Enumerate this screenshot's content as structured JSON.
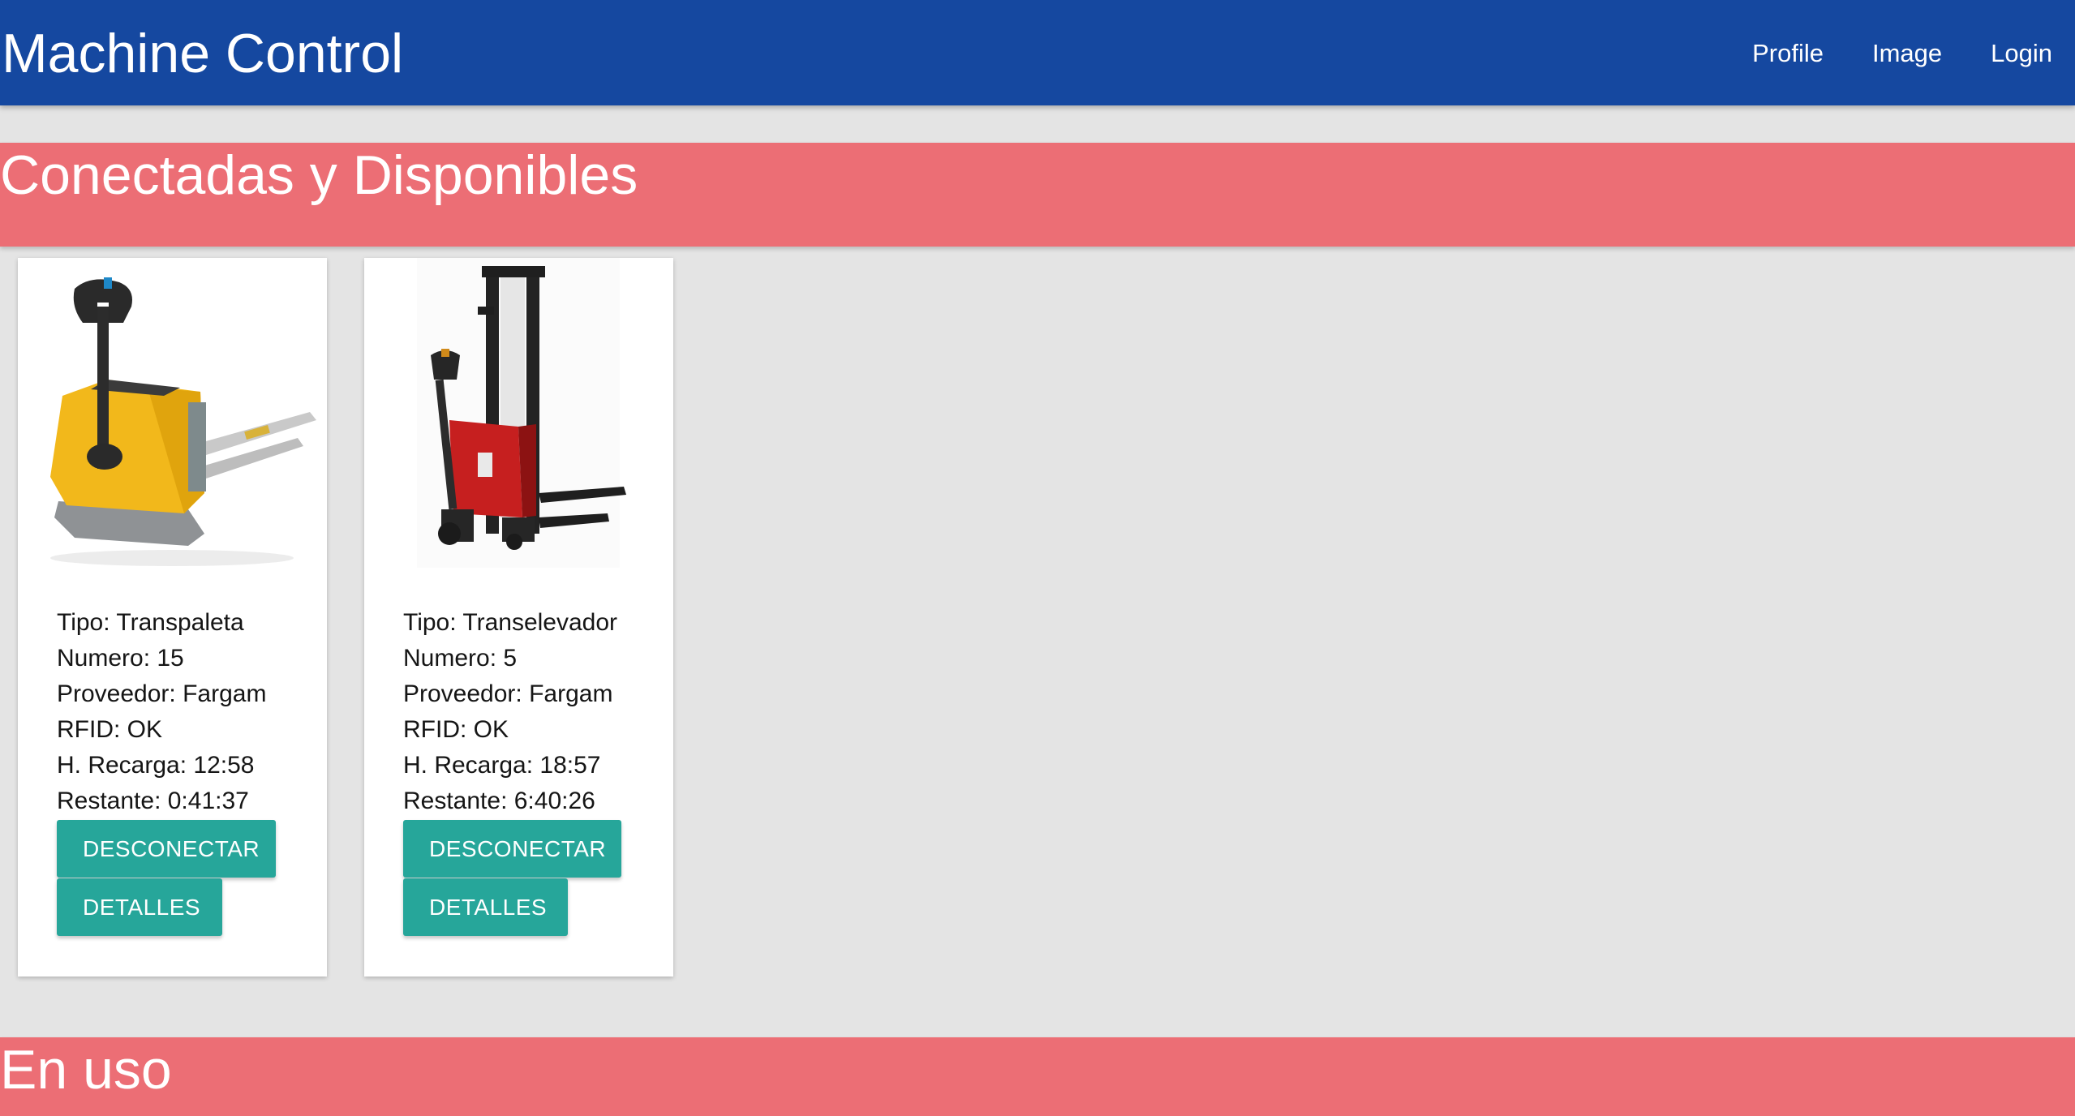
{
  "app": {
    "title": "Machine Control"
  },
  "nav": {
    "links": [
      {
        "label": "Profile"
      },
      {
        "label": "Image"
      },
      {
        "label": "Login"
      }
    ]
  },
  "sections": [
    {
      "title": "Conectadas y Disponibles"
    },
    {
      "title": "En uso"
    }
  ],
  "machines": [
    {
      "image": "pallet-jack-yellow",
      "tipo": "Tipo: Transpaleta",
      "numero": "Numero: 15",
      "proveedor": "Proveedor: Fargam",
      "rfid": "RFID: OK",
      "recarga": "H. Recarga: 12:58",
      "restante": "Restante: 0:41:37",
      "disconnect_label": "DESCONECTAR",
      "details_label": "DETALLES"
    },
    {
      "image": "stacker-red-black",
      "tipo": "Tipo: Transelevador",
      "numero": "Numero: 5",
      "proveedor": "Proveedor: Fargam",
      "rfid": "RFID: OK",
      "recarga": "H. Recarga: 18:57",
      "restante": "Restante: 6:40:26",
      "disconnect_label": "DESCONECTAR",
      "details_label": "DETALLES"
    }
  ],
  "colors": {
    "navbar": "#1548a0",
    "section": "#ec6e75",
    "button": "#26a69a",
    "background": "#e4e4e4"
  }
}
